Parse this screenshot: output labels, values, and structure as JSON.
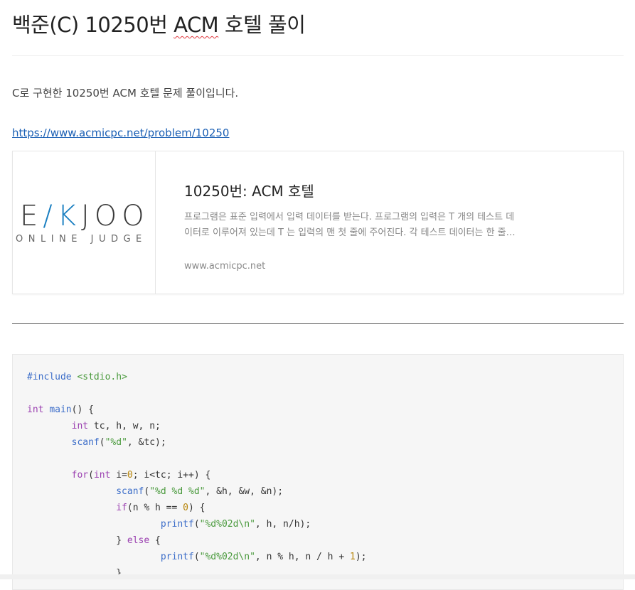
{
  "post": {
    "title_prefix": "백준(C) 10250번 ",
    "title_acm": "ACM",
    "title_suffix": " 호텔 풀이",
    "intro": "C로 구현한 10250번 ACM 호텔 문제 풀이입니다.",
    "link_text": "https://www.acmicpc.net/problem/10250"
  },
  "card": {
    "logo_main_a": "E",
    "logo_main_k": "/K",
    "logo_main_b": "JOO",
    "logo_sub": "ONLINE JUDGE",
    "title": "10250번: ACM 호텔",
    "description": "프로그램은 표준 입력에서 입력 데이터를 받는다. 프로그램의 입력은 T 개의 테스트 데이터로 이루어져 있는데 T 는 입력의 맨 첫 줄에 주어진다. 각 테스트 데이터는 한 줄로 구성되어 있는데 ...",
    "url": "www.acmicpc.net"
  },
  "code": {
    "language": "c",
    "lines": [
      "#include <stdio.h>",
      "",
      "int main() {",
      "\tint tc, h, w, n;",
      "\tscanf(\"%d\", &tc);",
      "",
      "\tfor(int i=0; i<tc; i++) {",
      "\t\tscanf(\"%d %d %d\", &h, &w, &n);",
      "\t\tif(n % h == 0) {",
      "\t\t\tprintf(\"%d%02d\\n\", h, n/h);",
      "\t\t} else {",
      "\t\t\tprintf(\"%d%02d\\n\", n % h, n / h + 1);",
      "\t\t}"
    ]
  }
}
